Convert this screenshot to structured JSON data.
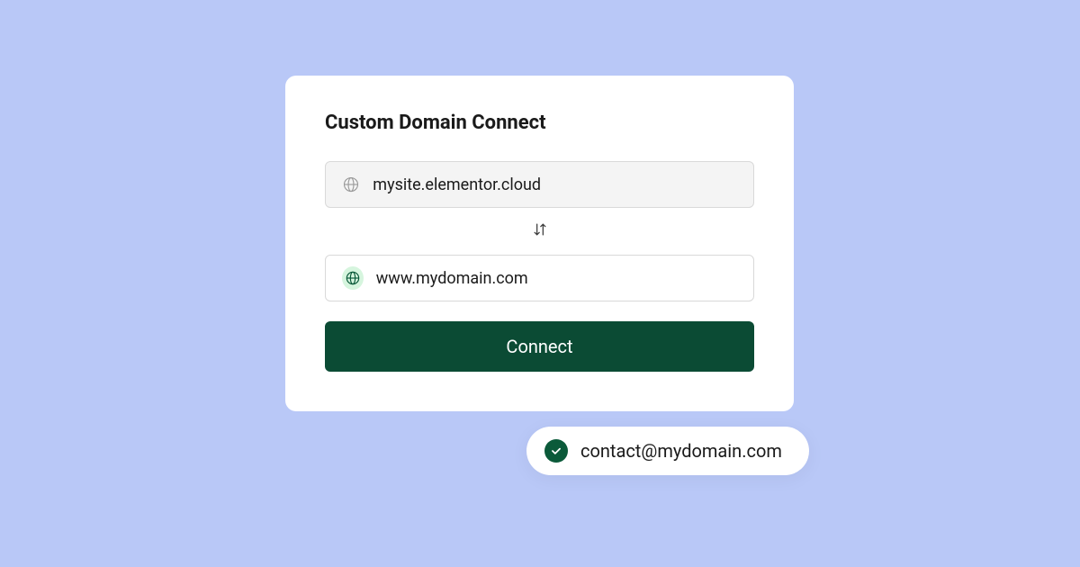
{
  "card": {
    "title": "Custom Domain Connect",
    "source_domain": "mysite.elementor.cloud",
    "target_domain": "www.mydomain.com",
    "connect_button": "Connect"
  },
  "email_badge": {
    "email": "contact@mydomain.com"
  }
}
